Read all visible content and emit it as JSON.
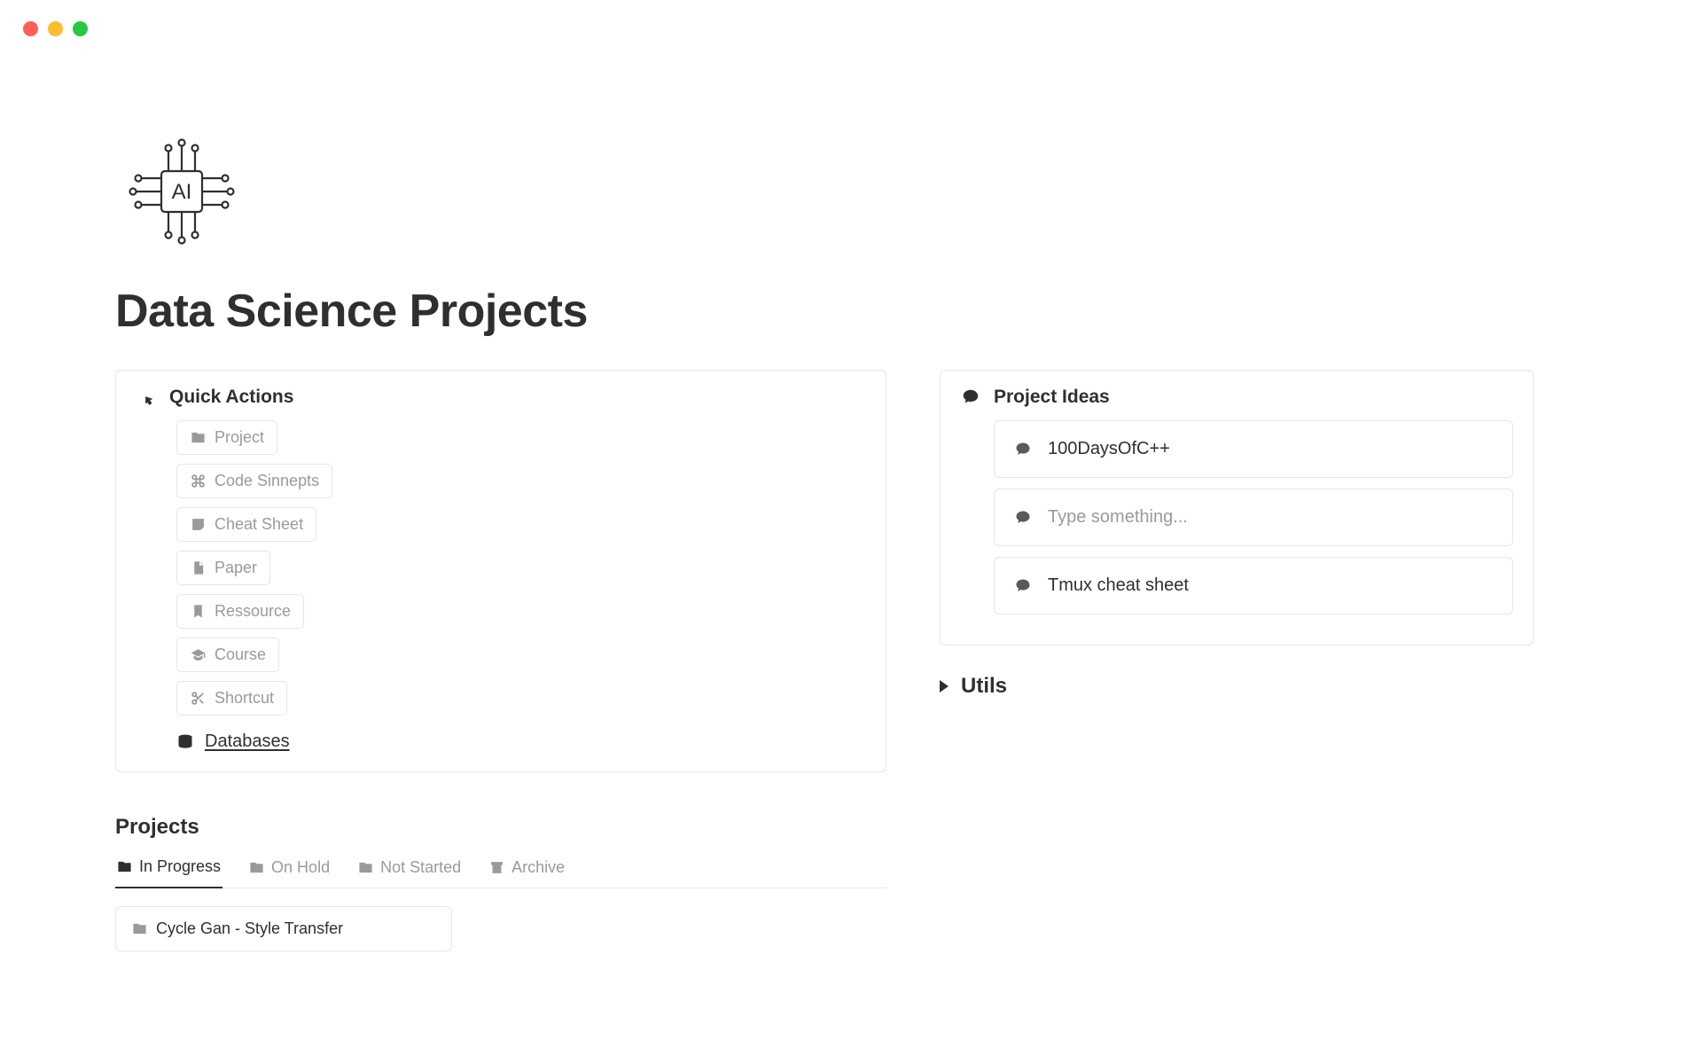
{
  "page": {
    "title": "Data Science Projects"
  },
  "quickActions": {
    "title": "Quick Actions",
    "items": [
      {
        "label": "Project",
        "icon": "folder"
      },
      {
        "label": "Code Sinnepts",
        "icon": "command"
      },
      {
        "label": "Cheat Sheet",
        "icon": "note"
      },
      {
        "label": "Paper",
        "icon": "page"
      },
      {
        "label": "Ressource",
        "icon": "bookmark"
      },
      {
        "label": "Course",
        "icon": "grad"
      },
      {
        "label": "Shortcut",
        "icon": "scissors"
      }
    ],
    "databasesLabel": "Databases"
  },
  "projectIdeas": {
    "title": "Project Ideas",
    "items": [
      {
        "label": "100DaysOfC++",
        "placeholder": false
      },
      {
        "label": "Type something...",
        "placeholder": true
      },
      {
        "label": "Tmux cheat sheet",
        "placeholder": false
      }
    ]
  },
  "utils": {
    "label": "Utils"
  },
  "projects": {
    "sectionTitle": "Projects",
    "tabs": [
      {
        "label": "In Progress",
        "active": true
      },
      {
        "label": "On Hold",
        "active": false
      },
      {
        "label": "Not Started",
        "active": false
      },
      {
        "label": "Archive",
        "active": false
      }
    ],
    "cards": [
      {
        "label": "Cycle Gan - Style Transfer"
      }
    ]
  }
}
